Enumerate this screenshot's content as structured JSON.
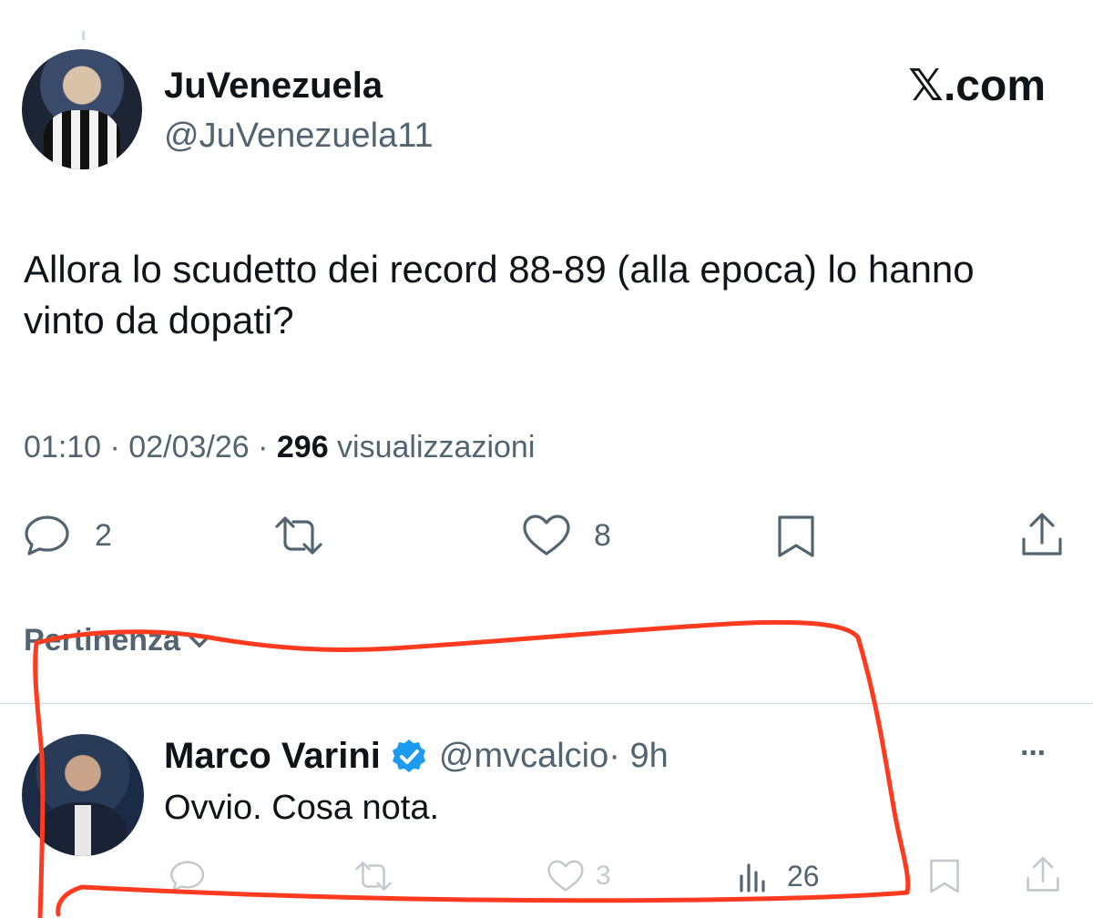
{
  "tweet": {
    "display_name": "JuVenezuela",
    "handle": "@JuVenezuela11",
    "brand": "𝕏.com",
    "text": "Allora lo scudetto dei record 88-89 (alla epoca) lo hanno vinto da dopati?",
    "time": "01:10 · 02/03/26 · ",
    "views_count": "296",
    "views_label": " visualizzazioni",
    "actions": {
      "replies": "2",
      "likes": "8"
    }
  },
  "sort_label": "Pertinenza",
  "reply": {
    "display_name": "Marco Varini",
    "handle": "@mvcalcio",
    "dot_time": " · 9h",
    "text": "Ovvio. Cosa nota.",
    "more": "···",
    "actions": {
      "likes": "3",
      "views": "26"
    }
  },
  "colors": {
    "verified": "#1d9bf0",
    "annotation": "#ff3b1f",
    "secondary_text": "#536471"
  }
}
